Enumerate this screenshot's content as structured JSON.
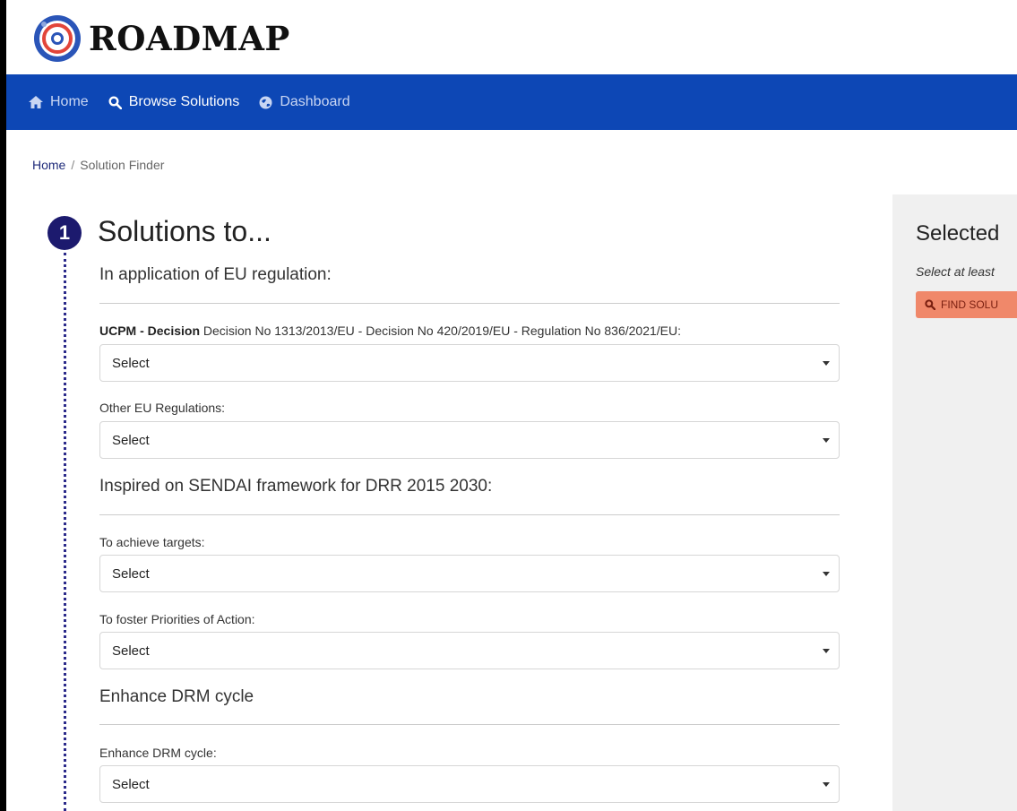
{
  "header": {
    "logo_text": "ROADMAP"
  },
  "nav": {
    "home": "Home",
    "browse": "Browse Solutions",
    "dashboard": "Dashboard"
  },
  "breadcrumb": {
    "home": "Home",
    "separator": "/",
    "current": "Solution Finder"
  },
  "step": {
    "number": "1",
    "title": "Solutions to...",
    "sections": {
      "eu": "In application of EU regulation:",
      "sendai": "Inspired on SENDAI framework for DRR 2015 2030:",
      "drm": "Enhance DRM cycle"
    },
    "fields": {
      "ucpm_bold": "UCPM - Decision",
      "ucpm_rest": " Decision No 1313/2013/EU - Decision No 420/2019/EU - Regulation No 836/2021/EU:",
      "other_eu": "Other EU Regulations:",
      "targets": "To achieve targets:",
      "priorities": "To foster Priorities of Action:",
      "drm_cycle": "Enhance DRM cycle:"
    },
    "select_value": "Select"
  },
  "right_panel": {
    "title": "Selected",
    "hint": "Select at least",
    "button": "FIND SOLU"
  },
  "colors": {
    "navbar": "#0d47b5",
    "step_circle": "#1c1a6e",
    "find_button": "#f0886a"
  }
}
